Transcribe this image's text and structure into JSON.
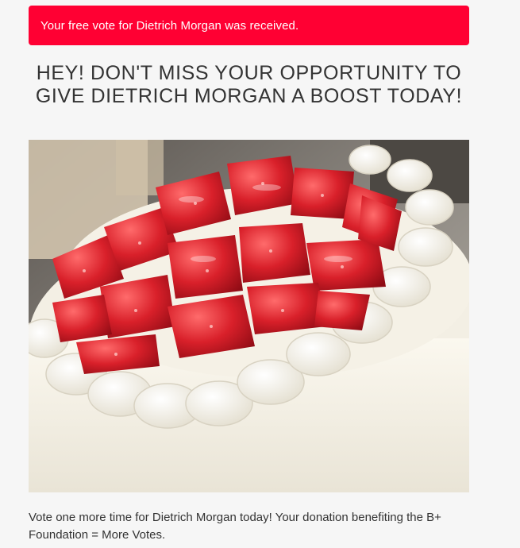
{
  "alert": {
    "text": "Your free vote for Dietrich Morgan was received."
  },
  "headline": {
    "text": "HEY! DON'T MISS YOUR OPPORTUNITY TO GIVE DIETRICH MORGAN A BOOST TODAY!"
  },
  "photo": {
    "subject": "strawberry-cake-photo"
  },
  "message": {
    "text": "Vote one more time for Dietrich Morgan today! Your donation benefiting the B+ Foundation = More Votes."
  },
  "colors": {
    "alert_background": "#ff0033",
    "alert_text": "#ffffff",
    "page_background": "#f6f6f6",
    "body_text": "#333333"
  }
}
